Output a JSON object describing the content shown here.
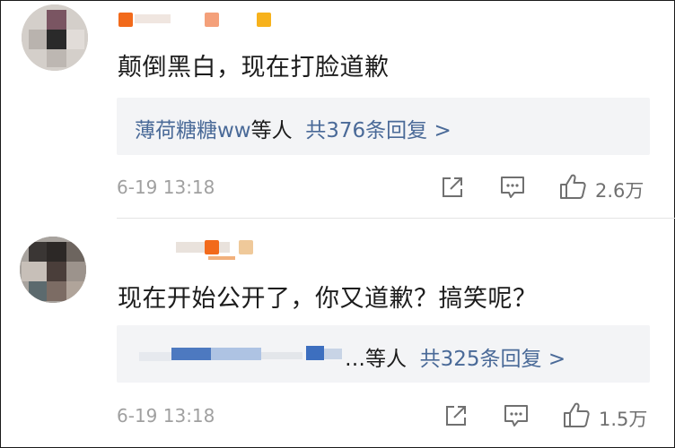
{
  "comments": [
    {
      "avatar": "avatar-image",
      "text": "颠倒黑白，现在打脸道歉",
      "reply_summary": {
        "names": "薄荷糖糖ww",
        "others": "等人",
        "count_link": "共376条回复 >"
      },
      "timestamp": "6-19 13:18",
      "icons": [
        "share-icon",
        "comment-icon",
        "like-icon"
      ],
      "likes": "2.6万"
    },
    {
      "avatar": "avatar-image",
      "text": "现在开始公开了，你又道歉？搞笑呢？",
      "reply_summary": {
        "names": "…",
        "others": "等人",
        "count_link": "共325条回复 >"
      },
      "timestamp": "6-19 13:18",
      "icons": [
        "share-icon",
        "comment-icon",
        "like-icon"
      ],
      "likes": "1.5万"
    }
  ],
  "colors": {
    "link": "#4a6a98",
    "text": "#1c1c1c",
    "muted": "#a0a0a0",
    "reply_bg": "#f3f4f6",
    "badge_orange": "#f26a1b",
    "badge_yellow": "#f7b21c",
    "badge_peach": "#f4a07a"
  }
}
